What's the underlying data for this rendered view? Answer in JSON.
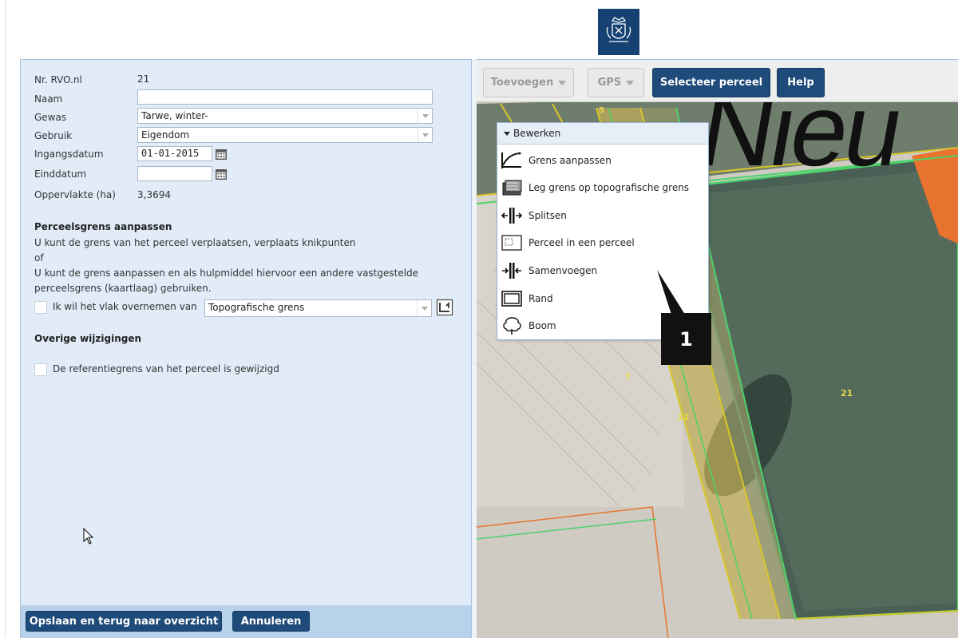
{
  "form": {
    "nr_label": "Nr. RVO.nl",
    "nr_value": "21",
    "naam_label": "Naam",
    "naam_value": "",
    "gewas_label": "Gewas",
    "gewas_value": "Tarwe, winter-",
    "gebruik_label": "Gebruik",
    "gebruik_value": "Eigendom",
    "ingang_label": "Ingangsdatum",
    "ingang_value": "01-01-2015",
    "eind_label": "Einddatum",
    "eind_value": "",
    "opp_label": "Oppervlakte (ha)",
    "opp_value": "3,3694"
  },
  "perceelsgrens": {
    "title": "Perceelsgrens aanpassen",
    "line1": "U kunt de grens van het perceel verplaatsen, verplaats knikpunten",
    "line2": "of",
    "line3": "U kunt de grens aanpassen en als hulpmiddel hiervoor een andere vastgestelde",
    "line4": "perceelsgrens (kaartlaag) gebruiken.",
    "checkbox_label": "Ik wil het vlak overnemen van",
    "select_value": "Topografische grens"
  },
  "overige": {
    "title": "Overige wijzigingen",
    "checkbox_label": "De referentiegrens van het perceel is gewijzigd"
  },
  "buttons": {
    "save": "Opslaan en terug naar overzicht",
    "cancel": "Annuleren"
  },
  "toolbar": {
    "toevoegen": "Toevoegen",
    "gps": "GPS",
    "selecteer": "Selecteer perceel",
    "help": "Help"
  },
  "menu": {
    "header": "Bewerken",
    "items": [
      {
        "label": "Grens aanpassen",
        "icon": "edit-boundary-icon"
      },
      {
        "label": "Leg grens op topografische grens",
        "icon": "topo-boundary-icon"
      },
      {
        "label": "Splitsen",
        "icon": "split-icon"
      },
      {
        "label": "Perceel in een perceel",
        "icon": "parcel-in-parcel-icon"
      },
      {
        "label": "Samenvoegen",
        "icon": "merge-icon"
      },
      {
        "label": "Rand",
        "icon": "border-icon"
      },
      {
        "label": "Boom",
        "icon": "tree-icon"
      }
    ]
  },
  "map": {
    "big_text": "Nieu",
    "parcel_labels": [
      "5",
      "7",
      "12",
      "21"
    ]
  },
  "callout": "1",
  "colors": {
    "button_blue": "#1f4b7a",
    "panel_bg": "#e1ecf8",
    "parcel_green": "#4cd26b",
    "parcel_yellow": "#d9c62a",
    "parcel_orange": "#e8732e"
  }
}
